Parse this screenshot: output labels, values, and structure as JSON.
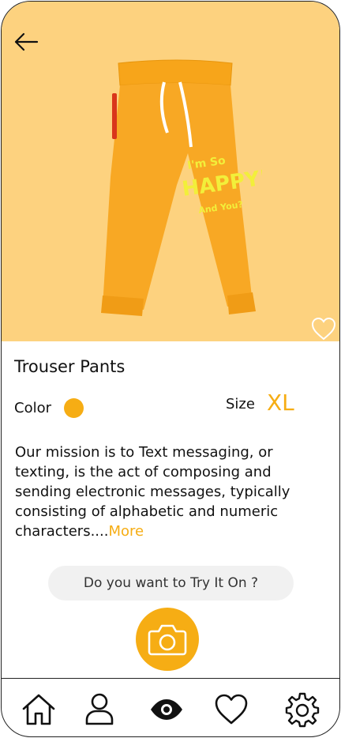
{
  "product": {
    "name": "Trouser Pants",
    "image_icon": "orange-jogger-pants-image",
    "print_text": [
      "I'm So",
      "HAPPY!",
      "And You?"
    ],
    "color_label": "Color",
    "selected_color": "#f6ad14",
    "size_label": "Size",
    "selected_size": "XL"
  },
  "description": {
    "text": "Our mission is to Text messaging, or texting, is the act of composing and sending electronic messages, typically consisting of alphabetic and numeric characters....",
    "more_label": "More"
  },
  "try_on": {
    "prompt": "Do you want to Try It On ?"
  },
  "nav": {
    "items": [
      {
        "icon": "home-icon"
      },
      {
        "icon": "user-icon"
      },
      {
        "icon": "eye-icon",
        "active": true
      },
      {
        "icon": "heart-icon"
      },
      {
        "icon": "settings-icon"
      }
    ]
  },
  "colors": {
    "hero_background": "#fdd27f",
    "accent": "#f6ad14",
    "pill_background": "#f1f1f1"
  }
}
